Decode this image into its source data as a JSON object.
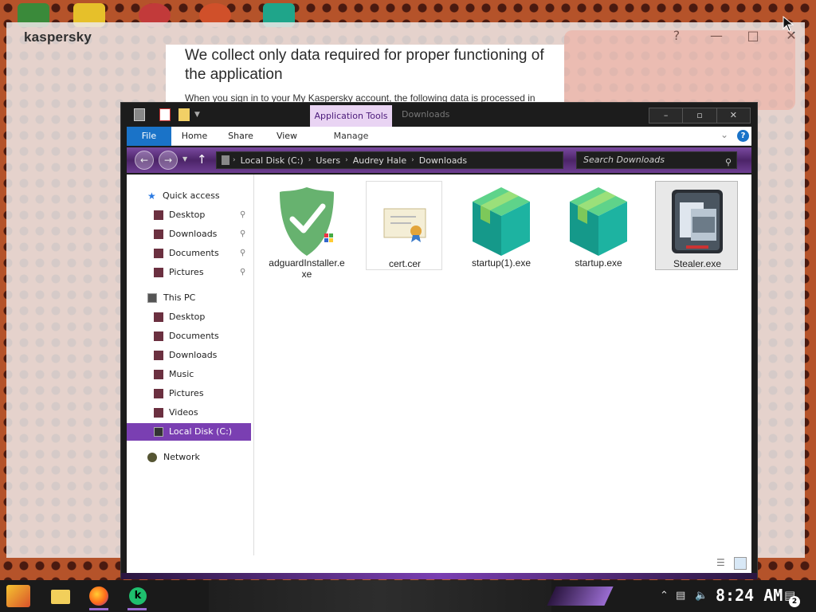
{
  "kaspersky": {
    "brand": "kaspersky",
    "heading": "We collect only data required for proper functioning of the application",
    "body_text": "When you sign in to your My Kaspersky account, the following data is processed in",
    "help_icon": "?",
    "minimize_icon": "—",
    "maximize_icon": "□",
    "close_icon": "✕"
  },
  "explorer": {
    "title": "Downloads",
    "app_tools_tab": "Application Tools",
    "ribbon_tabs": [
      "File",
      "Home",
      "Share",
      "View"
    ],
    "manage_tab": "Manage",
    "window_controls": {
      "minimize": "–",
      "maximize": "▫",
      "close": "✕"
    },
    "breadcrumb": [
      "Local Disk (C:)",
      "Users",
      "Audrey Hale",
      "Downloads"
    ],
    "search_placeholder": "Search Downloads",
    "nav": {
      "quick_access": "Quick access",
      "quick_items": [
        "Desktop",
        "Downloads",
        "Documents",
        "Pictures"
      ],
      "this_pc": "This PC",
      "pc_items": [
        "Desktop",
        "Documents",
        "Downloads",
        "Music",
        "Pictures",
        "Videos",
        "Local Disk (C:)"
      ],
      "network": "Network"
    },
    "files": [
      {
        "name": "adguardInstaller.exe",
        "icon": "adguard-shield-icon"
      },
      {
        "name": "cert.cer",
        "icon": "certificate-icon"
      },
      {
        "name": "startup(1).exe",
        "icon": "package-box-icon"
      },
      {
        "name": "startup.exe",
        "icon": "package-box-icon"
      },
      {
        "name": "Stealer.exe",
        "icon": "application-window-icon"
      }
    ],
    "selected_file": "Stealer.exe"
  },
  "taskbar": {
    "clock": "8:24 AM",
    "notification_count": "2",
    "apps": [
      "start-icon",
      "file-explorer-icon",
      "firefox-icon",
      "kaspersky-icon"
    ]
  },
  "colors": {
    "accent_purple": "#7a3fb2",
    "ribbon_file_blue": "#1a73c8",
    "adguard_green": "#67b26f",
    "box_teal": "#16a89a"
  }
}
